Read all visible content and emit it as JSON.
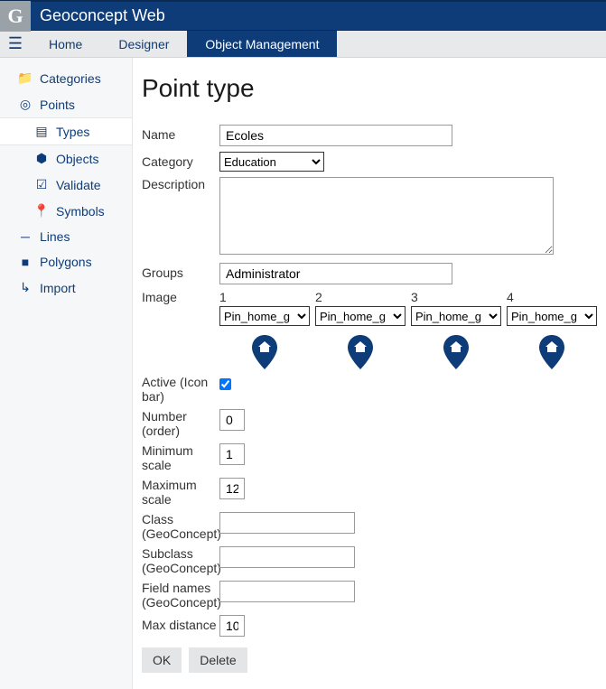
{
  "header": {
    "app_title": "Geoconcept Web"
  },
  "menu": {
    "home": "Home",
    "designer": "Designer",
    "object_management": "Object Management"
  },
  "sidebar": {
    "categories": "Categories",
    "points": "Points",
    "types": "Types",
    "objects": "Objects",
    "validate": "Validate",
    "symbols": "Symbols",
    "lines": "Lines",
    "polygons": "Polygons",
    "import": "Import"
  },
  "page": {
    "title": "Point type"
  },
  "form": {
    "name_label": "Name",
    "name_value": "Ecoles",
    "category_label": "Category",
    "category_value": "Education",
    "description_label": "Description",
    "description_value": "",
    "groups_label": "Groups",
    "groups_value": "Administrator",
    "image_label": "Image",
    "images": [
      {
        "num": "1",
        "value": "Pin_home_g"
      },
      {
        "num": "2",
        "value": "Pin_home_g"
      },
      {
        "num": "3",
        "value": "Pin_home_g"
      },
      {
        "num": "4",
        "value": "Pin_home_g"
      }
    ],
    "active_label": "Active (Icon bar)",
    "active_checked": true,
    "number_label": "Number (order)",
    "number_value": "0",
    "minscale_label": "Minimum scale",
    "minscale_value": "1",
    "maxscale_label": "Maximum scale",
    "maxscale_value": "12",
    "class_label": "Class (GeoConcept)",
    "class_value": "",
    "subclass_label": "Subclass (GeoConcept)",
    "subclass_value": "",
    "fieldnames_label": "Field names (GeoConcept)",
    "fieldnames_value": "",
    "maxdist_label": "Max distance",
    "maxdist_value": "10"
  },
  "buttons": {
    "ok": "OK",
    "delete": "Delete"
  }
}
